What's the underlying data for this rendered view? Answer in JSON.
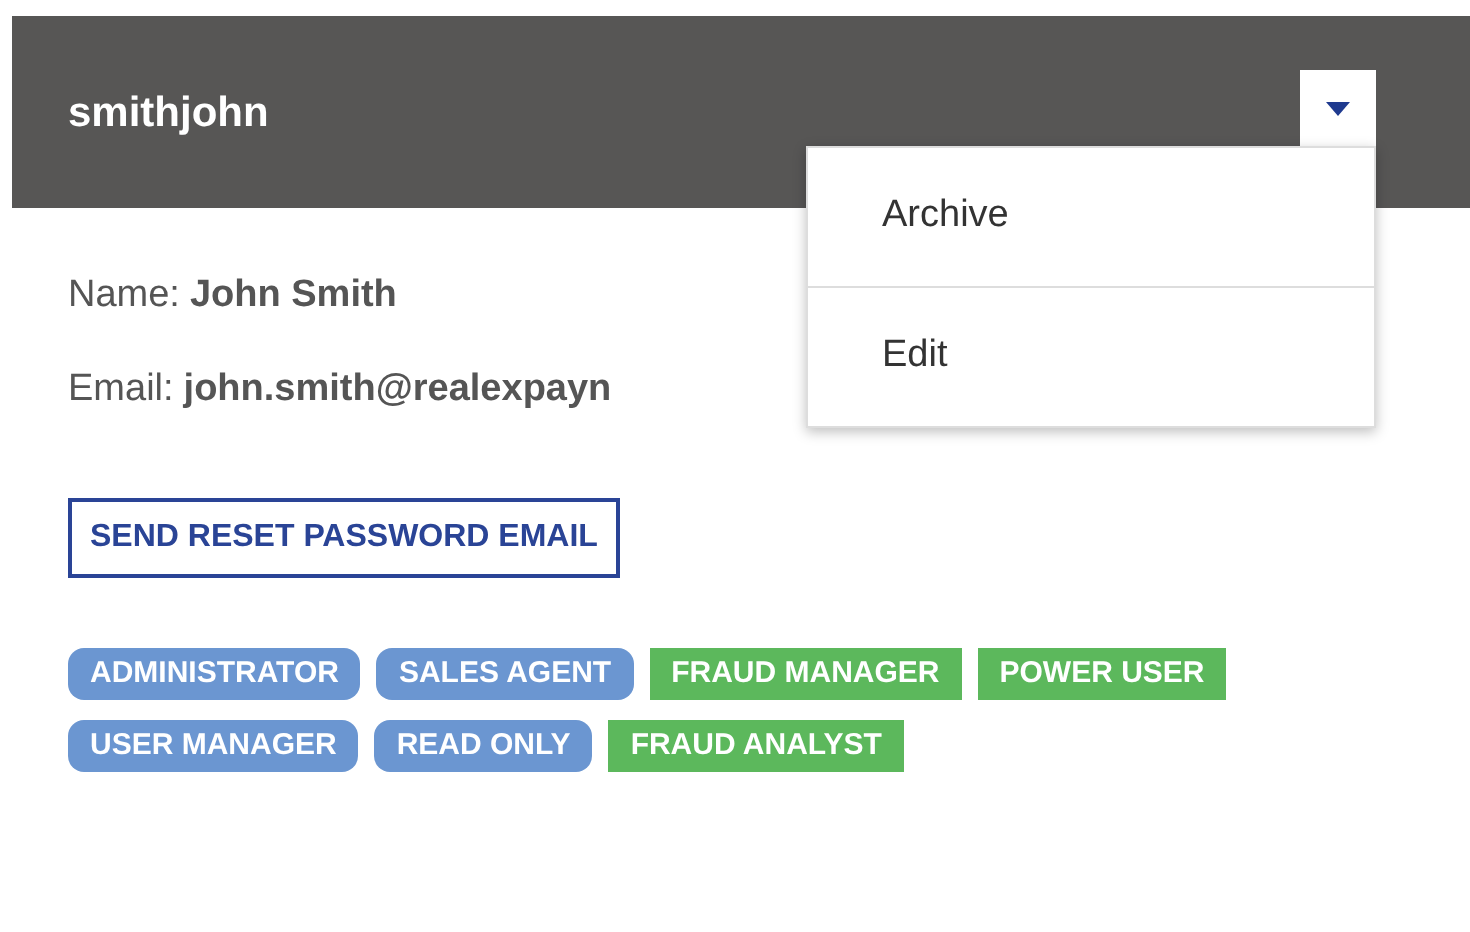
{
  "header": {
    "title": "smithjohn"
  },
  "menu": {
    "expanded": true,
    "items": [
      "Archive",
      "Edit"
    ]
  },
  "details": [
    {
      "label": "Name:",
      "value": "John Smith"
    },
    {
      "label": "Email:",
      "value": "john.smith@realexpayn"
    }
  ],
  "reset_button": "SEND RESET PASSWORD EMAIL",
  "tags": [
    {
      "label": "ADMINISTRATOR",
      "kind": "role"
    },
    {
      "label": "SALES AGENT",
      "kind": "role"
    },
    {
      "label": "FRAUD MANAGER",
      "kind": "permission"
    },
    {
      "label": "POWER USER",
      "kind": "permission"
    },
    {
      "label": "USER MANAGER",
      "kind": "role"
    },
    {
      "label": "READ ONLY",
      "kind": "role"
    },
    {
      "label": "FRAUD ANALYST",
      "kind": "permission"
    }
  ]
}
